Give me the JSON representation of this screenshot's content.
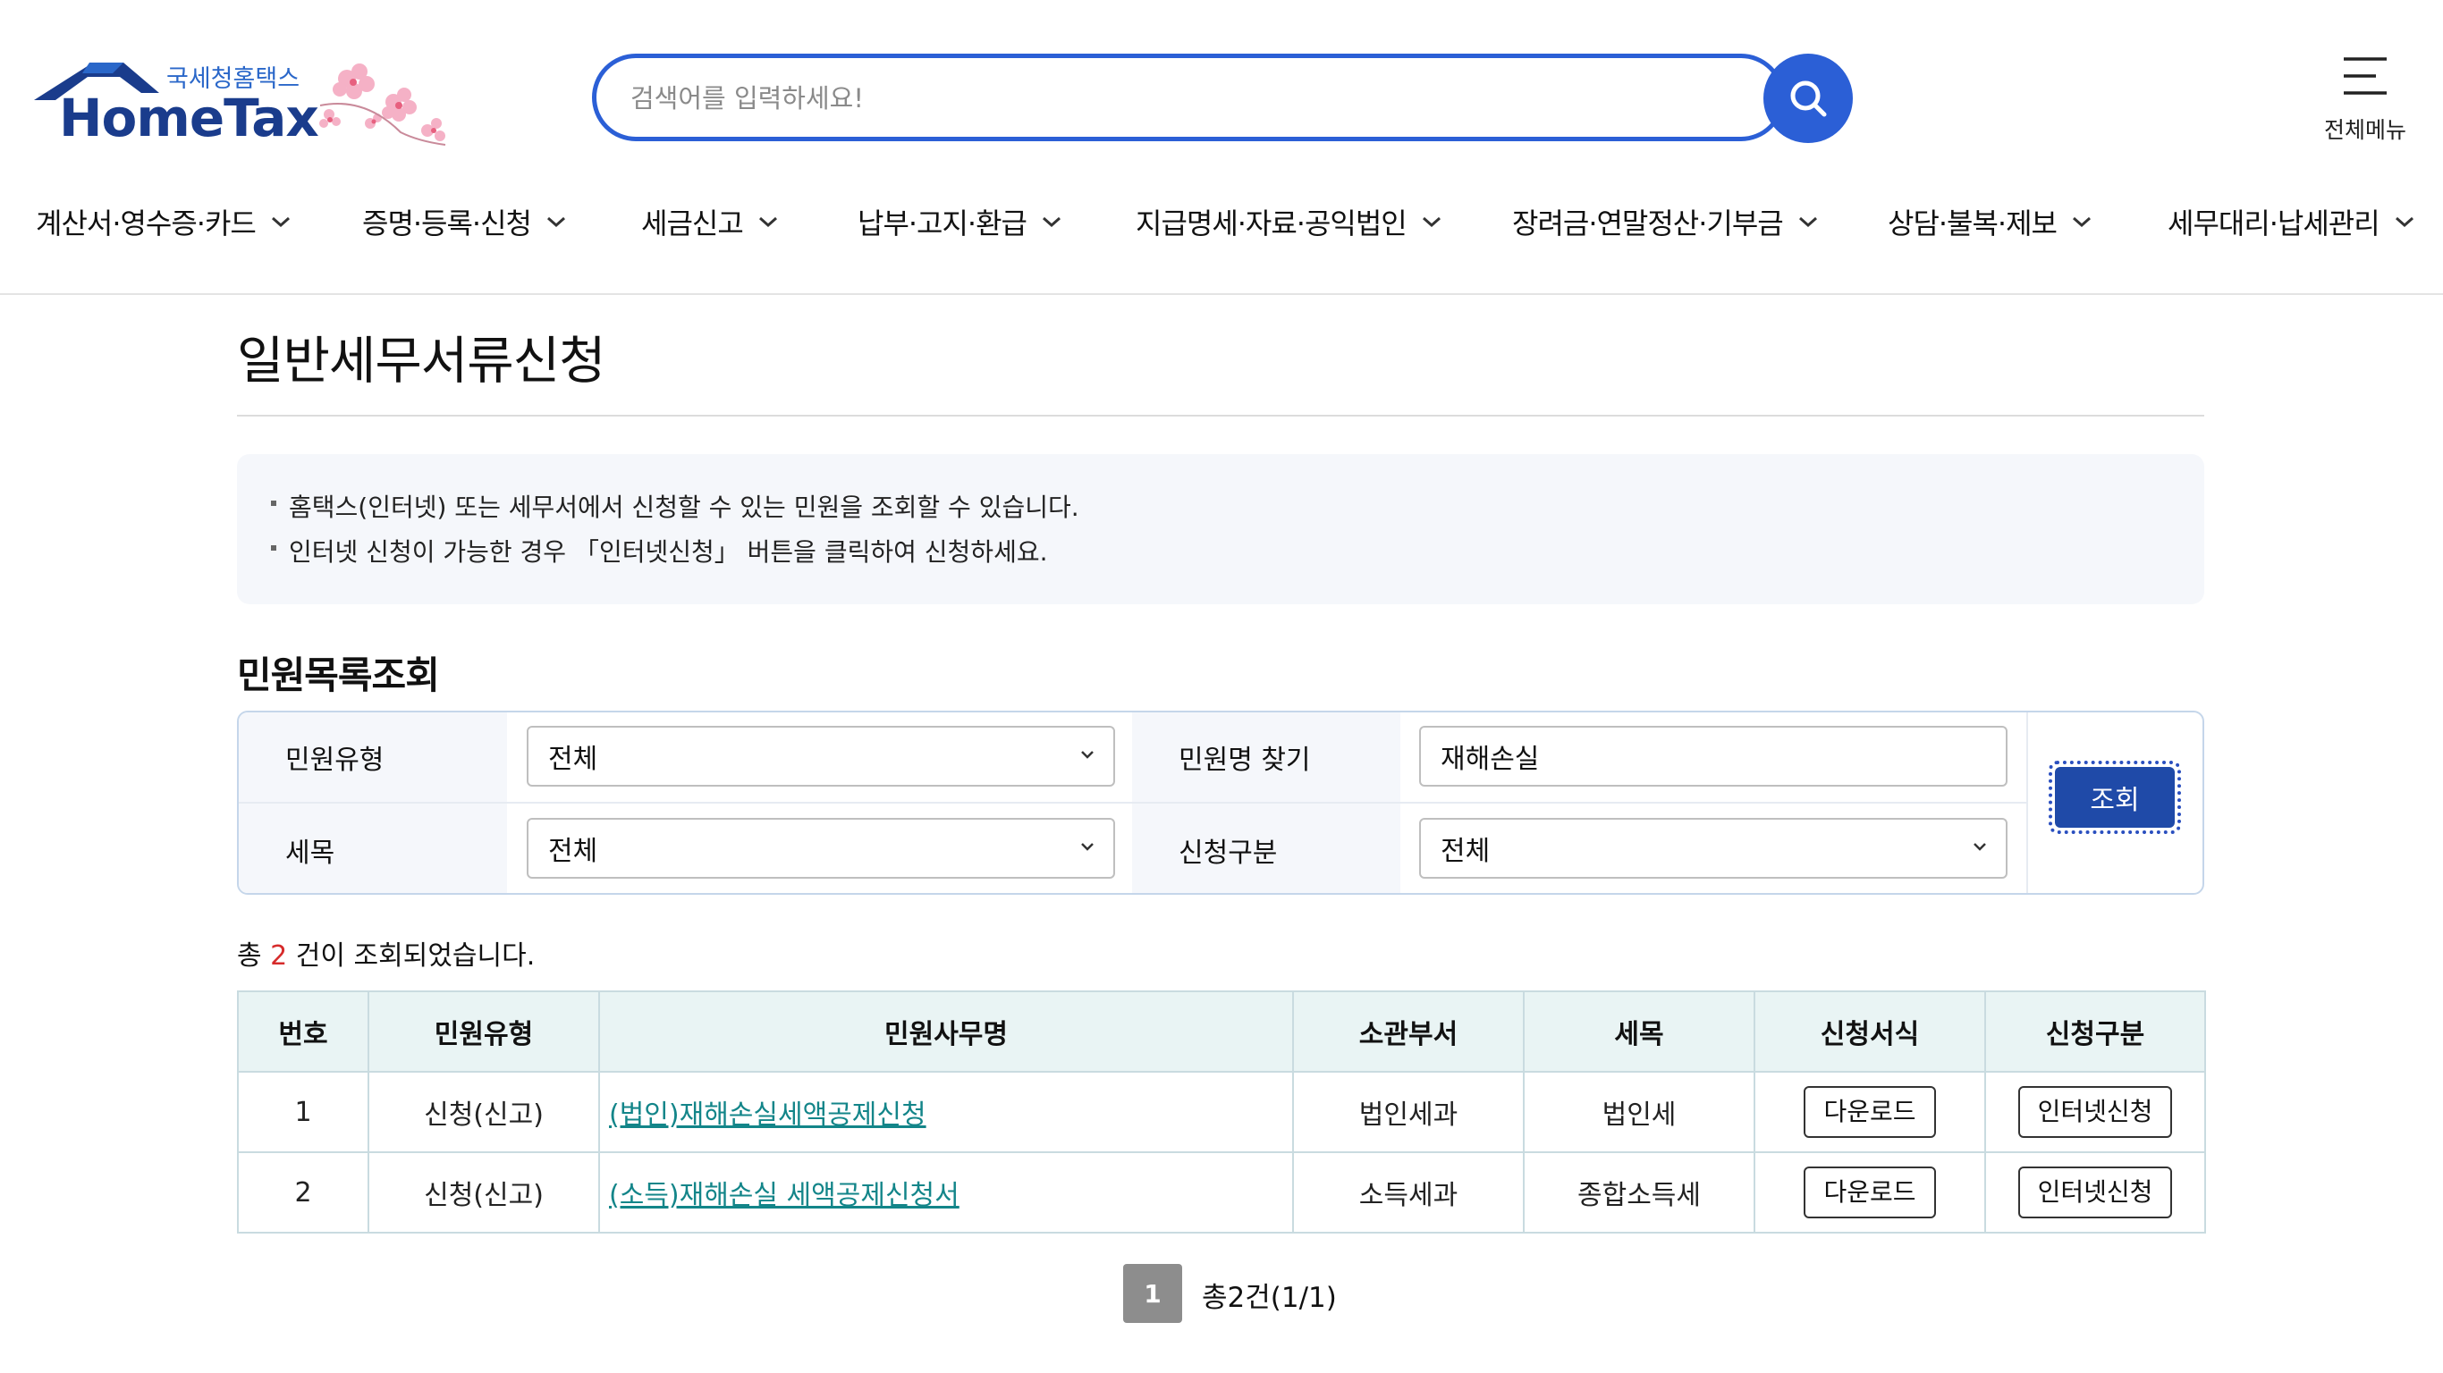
{
  "header": {
    "logo_sub": "국세청홈택스",
    "logo_main": "HomeTax",
    "search_placeholder": "검색어를 입력하세요!",
    "allmenu_label": "전체메뉴"
  },
  "gnb": [
    {
      "label": "계산서·영수증·카드"
    },
    {
      "label": "증명·등록·신청"
    },
    {
      "label": "세금신고"
    },
    {
      "label": "납부·고지·환급"
    },
    {
      "label": "지급명세·자료·공익법인"
    },
    {
      "label": "장려금·연말정산·기부금"
    },
    {
      "label": "상담·불복·제보"
    },
    {
      "label": "세무대리·납세관리"
    }
  ],
  "page": {
    "title": "일반세무서류신청",
    "notices": [
      "홈택스(인터넷) 또는 세무서에서 신청할 수 있는 민원을 조회할 수 있습니다.",
      "인터넷 신청이 가능한 경우 「인터넷신청」 버튼을 클릭하여 신청하세요."
    ],
    "section_title": "민원목록조회"
  },
  "search": {
    "type_label": "민원유형",
    "type_value": "전체",
    "name_label": "민원명 찾기",
    "name_value": "재해손실",
    "tax_label": "세목",
    "tax_value": "전체",
    "apply_label": "신청구분",
    "apply_value": "전체",
    "query_button": "조회"
  },
  "result": {
    "prefix": "총",
    "count": "2",
    "suffix": "건이 조회되었습니다."
  },
  "table": {
    "headers": [
      "번호",
      "민원유형",
      "민원사무명",
      "소관부서",
      "세목",
      "신청서식",
      "신청구분"
    ],
    "rows": [
      {
        "no": "1",
        "type": "신청(신고)",
        "name": "(법인)재해손실세액공제신청",
        "dept": "법인세과",
        "tax": "법인세",
        "form": "다운로드",
        "apply": "인터넷신청"
      },
      {
        "no": "2",
        "type": "신청(신고)",
        "name": "(소득)재해손실 세액공제신청서",
        "dept": "소득세과",
        "tax": "종합소득세",
        "form": "다운로드",
        "apply": "인터넷신청"
      }
    ]
  },
  "pager": {
    "current": "1",
    "total": "총2건(1/1)"
  },
  "colors": {
    "brand_blue": "#2b5fd6",
    "button_navy": "#1f4aa8",
    "link_teal": "#138589",
    "count_red": "#d62b2b",
    "table_header": "#e9f4f4"
  }
}
